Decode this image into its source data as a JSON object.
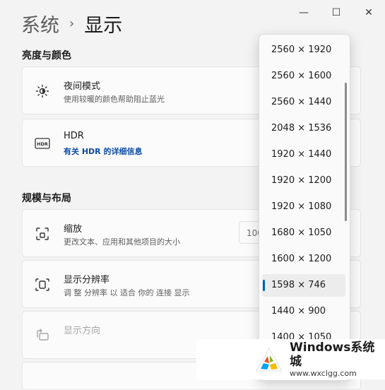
{
  "window": {
    "minimize": "—",
    "maximize": "☐",
    "close": "✕"
  },
  "breadcrumb": {
    "parent": "系统",
    "separator": "›",
    "current": "显示"
  },
  "sections": {
    "brightness": "亮度与颜色",
    "scale_layout": "规模与布局"
  },
  "cards": {
    "night_light": {
      "title": "夜间模式",
      "subtitle": "使用较暖的颜色帮助阻止蓝光",
      "icon": "brightness-icon"
    },
    "hdr": {
      "title": "HDR",
      "link": "有关 HDR 的详细信息",
      "icon": "hdr-icon"
    },
    "scale": {
      "title": "缩放",
      "subtitle": "更改文本、应用和其他项目的大小",
      "value": "100",
      "icon": "scale-icon"
    },
    "resolution": {
      "title": "显示分辨率",
      "subtitle": "调 整 分辨率 以 适合 你的 连接 显示",
      "icon": "resolution-icon"
    },
    "orientation": {
      "title": "显示方向",
      "icon": "orientation-icon"
    }
  },
  "resolution_options": [
    "2560 × 1920",
    "2560 × 1600",
    "2560 × 1440",
    "2048 × 1536",
    "1920 × 1440",
    "1920 × 1200",
    "1920 × 1080",
    "1680 × 1050",
    "1600 × 1200",
    "1598 × 746",
    "1440 × 900",
    "1400 × 1050"
  ],
  "selected_resolution": "1598 × 746",
  "watermark": {
    "title": "Windows系统城",
    "url": "www.wxclgg.com"
  },
  "colors": {
    "accent": "#005fb8",
    "link": "#0b4ba3"
  }
}
